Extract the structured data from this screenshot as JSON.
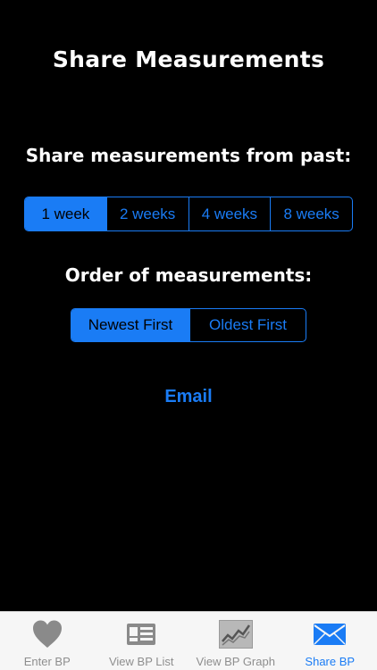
{
  "title": "Share Measurements",
  "past": {
    "label": "Share measurements from past:",
    "options": [
      "1 week",
      "2 weeks",
      "4 weeks",
      "8 weeks"
    ],
    "selected": "1 week"
  },
  "order": {
    "label": "Order of measurements:",
    "options": [
      "Newest First",
      "Oldest First"
    ],
    "selected": "Newest First"
  },
  "email_label": "Email",
  "tabbar": {
    "items": [
      {
        "label": "Enter BP",
        "icon": "heart-icon"
      },
      {
        "label": "View BP List",
        "icon": "list-card-icon"
      },
      {
        "label": "View BP Graph",
        "icon": "graph-icon"
      },
      {
        "label": "Share BP",
        "icon": "envelope-icon"
      }
    ],
    "active": "Share BP"
  },
  "colors": {
    "accent": "#1a7cf5",
    "background": "#000000",
    "tabbar_bg": "#f6f6f6",
    "inactive": "#8e8e8e"
  }
}
